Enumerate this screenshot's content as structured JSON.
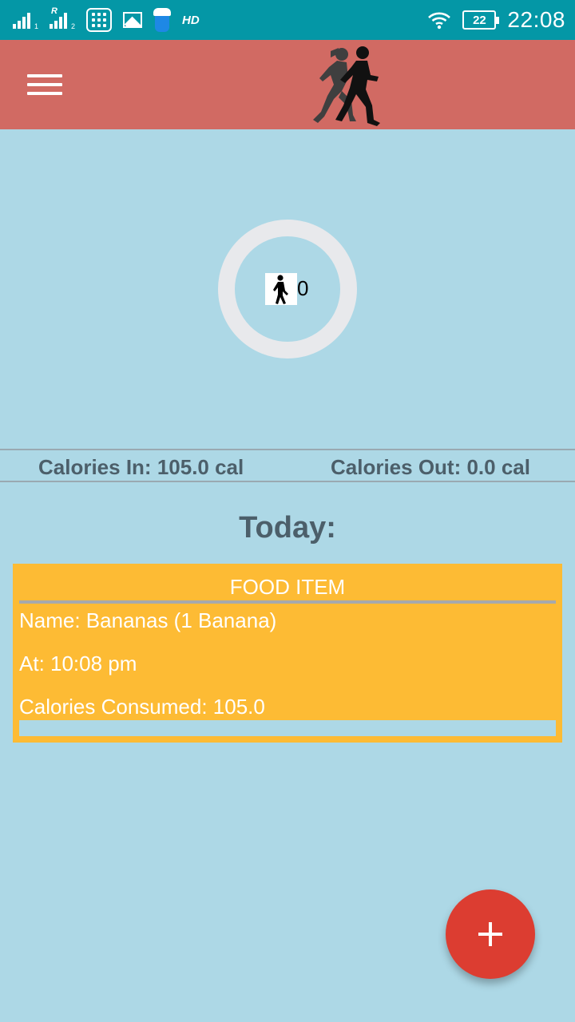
{
  "status_bar": {
    "time": "22:08",
    "battery_level": "22",
    "hd_label": "HD",
    "signal_1_sub": "1",
    "signal_2_sub": "2",
    "signal_2_roaming": "R"
  },
  "app_bar": {
    "menu_icon": "hamburger-menu-icon",
    "logo_icon": "runners-silhouette-icon"
  },
  "steps": {
    "icon": "walking-person-icon",
    "count": "0"
  },
  "calories": {
    "in_label": "Calories In: 105.0 cal",
    "out_label": "Calories Out: 0.0 cal"
  },
  "today_heading": "Today:",
  "food_card": {
    "title": "FOOD ITEM",
    "name_line": "Name: Bananas (1 Banana)",
    "time_line": "At: 10:08 pm",
    "calories_line": "Calories Consumed: 105.0"
  },
  "fab": {
    "icon": "plus-icon"
  },
  "colors": {
    "status_bar": "#0497a6",
    "app_bar": "#d16a63",
    "background": "#add8e6",
    "card": "#fdbb34",
    "fab": "#dc3d31",
    "text_dark": "#4c5f6a"
  }
}
